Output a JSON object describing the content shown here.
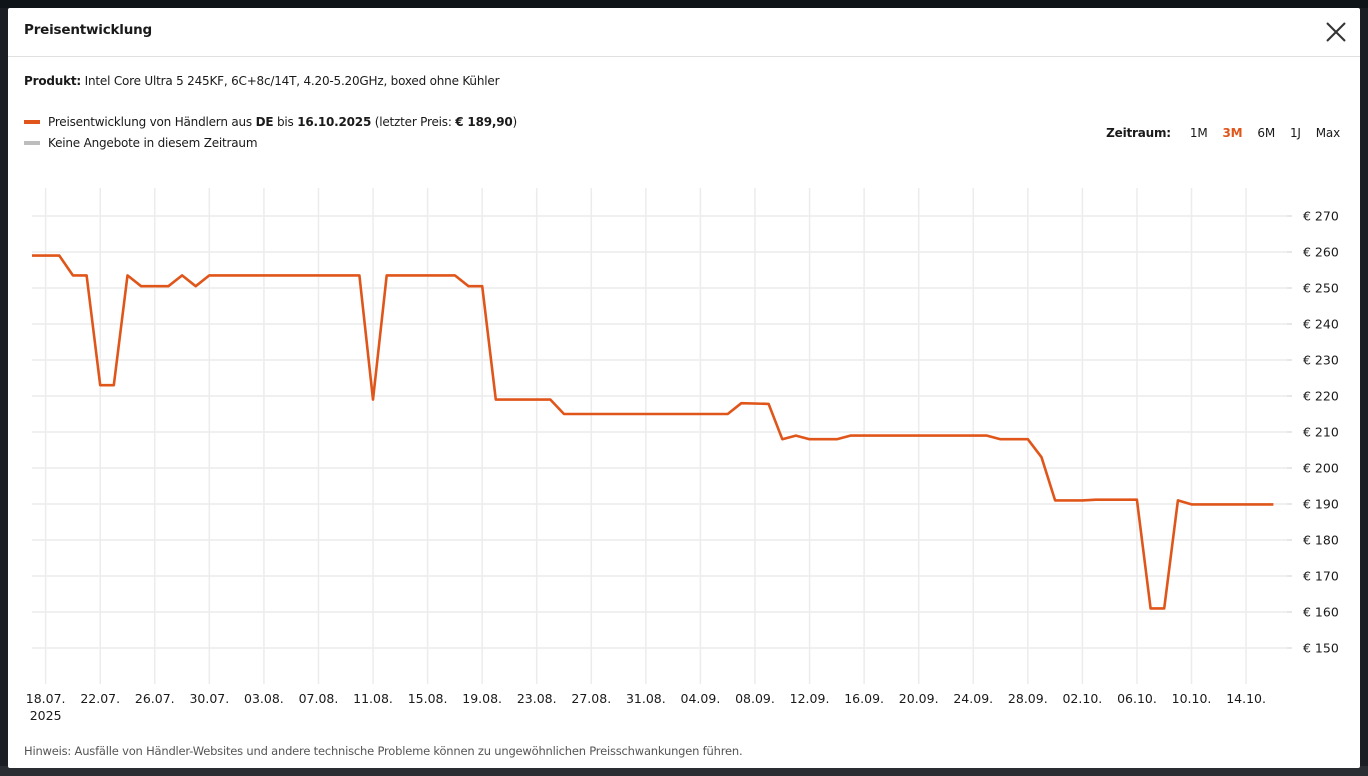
{
  "modal": {
    "title": "Preisentwicklung",
    "product_label": "Produkt:",
    "product_name": "Intel Core Ultra 5 245KF, 6C+8c/14T, 4.20-5.20GHz, boxed ohne Kühler",
    "legend": {
      "series_prefix": "Preisentwicklung von Händlern aus ",
      "country": "DE",
      "until_text": " bis ",
      "date": "16.10.2025",
      "last_price_prefix": " (letzter Preis: ",
      "last_price": "€ 189,90",
      "last_price_suffix": ")",
      "no_offers": "Keine Angebote in diesem Zeitraum"
    },
    "timerange": {
      "label": "Zeitraum:",
      "options": [
        "1M",
        "3M",
        "6M",
        "1J",
        "Max"
      ],
      "active": "3M"
    },
    "footnote": "Hinweis: Ausfälle von Händler-Websites und andere technische Probleme können zu ungewöhnlichen Preisschwankungen führen."
  },
  "colors": {
    "series": "#e0561a",
    "no_offers": "#bdbdbd",
    "grid": "#ececec",
    "active_option": "#e0561a"
  },
  "icons": {
    "close": "close-icon"
  },
  "chart_data": {
    "type": "line",
    "title": "",
    "xlabel": "",
    "ylabel": "",
    "y_unit_prefix": "€",
    "ylim": [
      140,
      275
    ],
    "yticks": [
      150,
      160,
      170,
      180,
      190,
      200,
      210,
      220,
      230,
      240,
      250,
      260,
      270
    ],
    "xlim": [
      "2025-07-17",
      "2025-10-17"
    ],
    "xticks": [
      {
        "date": "2025-07-18",
        "label": "18.07."
      },
      {
        "date": "2025-07-22",
        "label": "22.07."
      },
      {
        "date": "2025-07-26",
        "label": "26.07."
      },
      {
        "date": "2025-07-30",
        "label": "30.07."
      },
      {
        "date": "2025-08-03",
        "label": "03.08."
      },
      {
        "date": "2025-08-07",
        "label": "07.08."
      },
      {
        "date": "2025-08-11",
        "label": "11.08."
      },
      {
        "date": "2025-08-15",
        "label": "15.08."
      },
      {
        "date": "2025-08-19",
        "label": "19.08."
      },
      {
        "date": "2025-08-23",
        "label": "23.08."
      },
      {
        "date": "2025-08-27",
        "label": "27.08."
      },
      {
        "date": "2025-08-31",
        "label": "31.08."
      },
      {
        "date": "2025-09-04",
        "label": "04.09."
      },
      {
        "date": "2025-09-08",
        "label": "08.09."
      },
      {
        "date": "2025-09-12",
        "label": "12.09."
      },
      {
        "date": "2025-09-16",
        "label": "16.09."
      },
      {
        "date": "2025-09-20",
        "label": "20.09."
      },
      {
        "date": "2025-09-24",
        "label": "24.09."
      },
      {
        "date": "2025-09-28",
        "label": "28.09."
      },
      {
        "date": "2025-10-02",
        "label": "02.10."
      },
      {
        "date": "2025-10-06",
        "label": "06.10."
      },
      {
        "date": "2025-10-10",
        "label": "10.10."
      },
      {
        "date": "2025-10-14",
        "label": "14.10."
      }
    ],
    "year_label": "2025",
    "grid": true,
    "legend_position": "top-left",
    "series": [
      {
        "name": "Preisentwicklung von Händlern aus DE",
        "points": [
          [
            "2025-07-17",
            259.0
          ],
          [
            "2025-07-19",
            259.0
          ],
          [
            "2025-07-20",
            253.5
          ],
          [
            "2025-07-21",
            253.5
          ],
          [
            "2025-07-22",
            223.0
          ],
          [
            "2025-07-23",
            223.0
          ],
          [
            "2025-07-24",
            253.5
          ],
          [
            "2025-07-25",
            250.5
          ],
          [
            "2025-07-27",
            250.5
          ],
          [
            "2025-07-28",
            253.5
          ],
          [
            "2025-07-29",
            250.5
          ],
          [
            "2025-07-30",
            253.5
          ],
          [
            "2025-08-10",
            253.5
          ],
          [
            "2025-08-11",
            219.0
          ],
          [
            "2025-08-12",
            253.5
          ],
          [
            "2025-08-17",
            253.5
          ],
          [
            "2025-08-18",
            250.5
          ],
          [
            "2025-08-19",
            250.5
          ],
          [
            "2025-08-20",
            219.0
          ],
          [
            "2025-08-24",
            219.0
          ],
          [
            "2025-08-25",
            215.0
          ],
          [
            "2025-09-06",
            215.0
          ],
          [
            "2025-09-07",
            218.0
          ],
          [
            "2025-09-09",
            217.8
          ],
          [
            "2025-09-10",
            208.0
          ],
          [
            "2025-09-11",
            209.0
          ],
          [
            "2025-09-12",
            208.0
          ],
          [
            "2025-09-14",
            208.0
          ],
          [
            "2025-09-15",
            209.0
          ],
          [
            "2025-09-25",
            209.0
          ],
          [
            "2025-09-26",
            208.0
          ],
          [
            "2025-09-28",
            208.0
          ],
          [
            "2025-09-29",
            203.0
          ],
          [
            "2025-09-30",
            191.0
          ],
          [
            "2025-10-02",
            191.0
          ],
          [
            "2025-10-03",
            191.2
          ],
          [
            "2025-10-06",
            191.2
          ],
          [
            "2025-10-07",
            161.0
          ],
          [
            "2025-10-08",
            161.0
          ],
          [
            "2025-10-09",
            191.0
          ],
          [
            "2025-10-10",
            189.9
          ],
          [
            "2025-10-16",
            189.9
          ]
        ]
      }
    ]
  }
}
